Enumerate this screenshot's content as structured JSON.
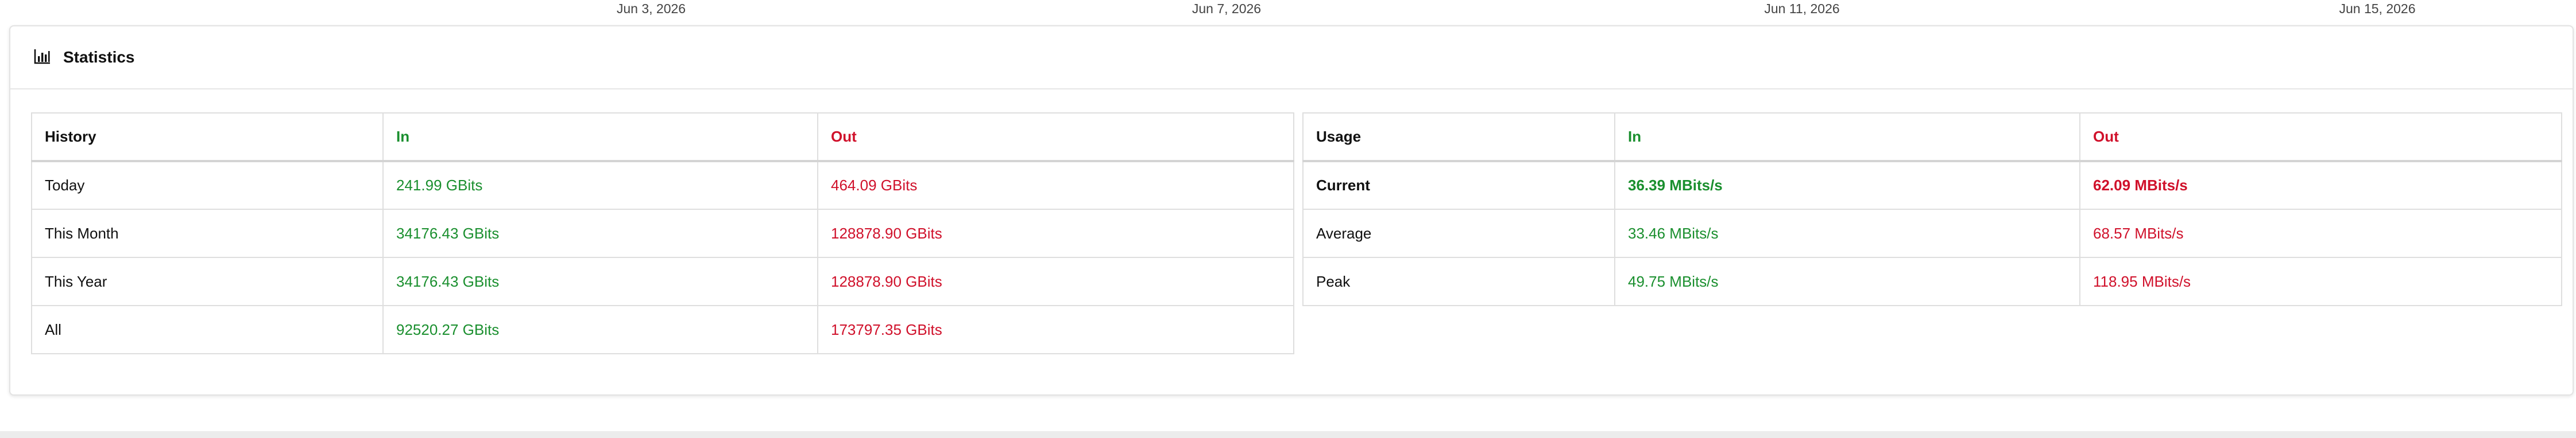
{
  "date_axis": [
    "Jun 3, 2026",
    "Jun 7, 2026",
    "Jun 11, 2026",
    "Jun 15, 2026"
  ],
  "statistics": {
    "title": "Statistics",
    "icon": "bar-chart-icon",
    "colors": {
      "in": "#1a8f2e",
      "out": "#d0112b"
    },
    "history": {
      "headers": [
        "History",
        "In",
        "Out"
      ],
      "rows": [
        {
          "label": "Today",
          "in": "241.99 GBits",
          "out": "464.09 GBits"
        },
        {
          "label": "This Month",
          "in": "34176.43 GBits",
          "out": "128878.90 GBits"
        },
        {
          "label": "This Year",
          "in": "34176.43 GBits",
          "out": "128878.90 GBits"
        },
        {
          "label": "All",
          "in": "92520.27 GBits",
          "out": "173797.35 GBits"
        }
      ]
    },
    "usage": {
      "headers": [
        "Usage",
        "In",
        "Out"
      ],
      "rows": [
        {
          "label": "Current",
          "in": "36.39 MBits/s",
          "out": "62.09 MBits/s"
        },
        {
          "label": "Average",
          "in": "33.46 MBits/s",
          "out": "68.57 MBits/s"
        },
        {
          "label": "Peak",
          "in": "49.75 MBits/s",
          "out": "118.95 MBits/s"
        }
      ]
    }
  }
}
